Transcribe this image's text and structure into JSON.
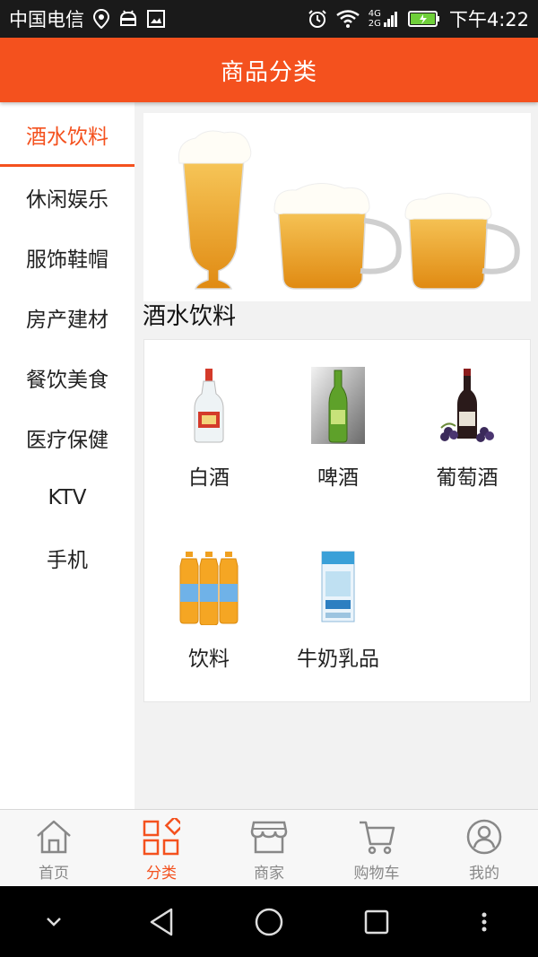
{
  "status_bar": {
    "carrier": "中国电信",
    "network": "4G\n2G",
    "network_top": "4G",
    "network_bottom": "2G",
    "time": "下午4:22"
  },
  "header": {
    "title": "商品分类"
  },
  "sidebar": {
    "items": [
      {
        "label": "酒水饮料",
        "active": true
      },
      {
        "label": "休闲娱乐"
      },
      {
        "label": "服饰鞋帽"
      },
      {
        "label": "房产建材"
      },
      {
        "label": "餐饮美食"
      },
      {
        "label": "医疗保健"
      },
      {
        "label": "KTV"
      },
      {
        "label": "手机"
      }
    ]
  },
  "main": {
    "section_title": "酒水饮料",
    "categories": [
      {
        "label": "白酒",
        "icon": "baijiu-bottle-image"
      },
      {
        "label": "啤酒",
        "icon": "beer-bottle-image"
      },
      {
        "label": "葡萄酒",
        "icon": "wine-bottle-image"
      },
      {
        "label": "饮料",
        "icon": "drink-bottles-image"
      },
      {
        "label": "牛奶乳品",
        "icon": "milk-carton-image"
      }
    ]
  },
  "bottom_nav": {
    "items": [
      {
        "label": "首页",
        "icon": "home-icon"
      },
      {
        "label": "分类",
        "icon": "category-icon",
        "active": true
      },
      {
        "label": "商家",
        "icon": "store-icon"
      },
      {
        "label": "购物车",
        "icon": "cart-icon"
      },
      {
        "label": "我的",
        "icon": "profile-icon"
      }
    ]
  },
  "colors": {
    "accent": "#f4511e",
    "status_bar": "#1a1a1a",
    "inactive_nav": "#888888"
  }
}
